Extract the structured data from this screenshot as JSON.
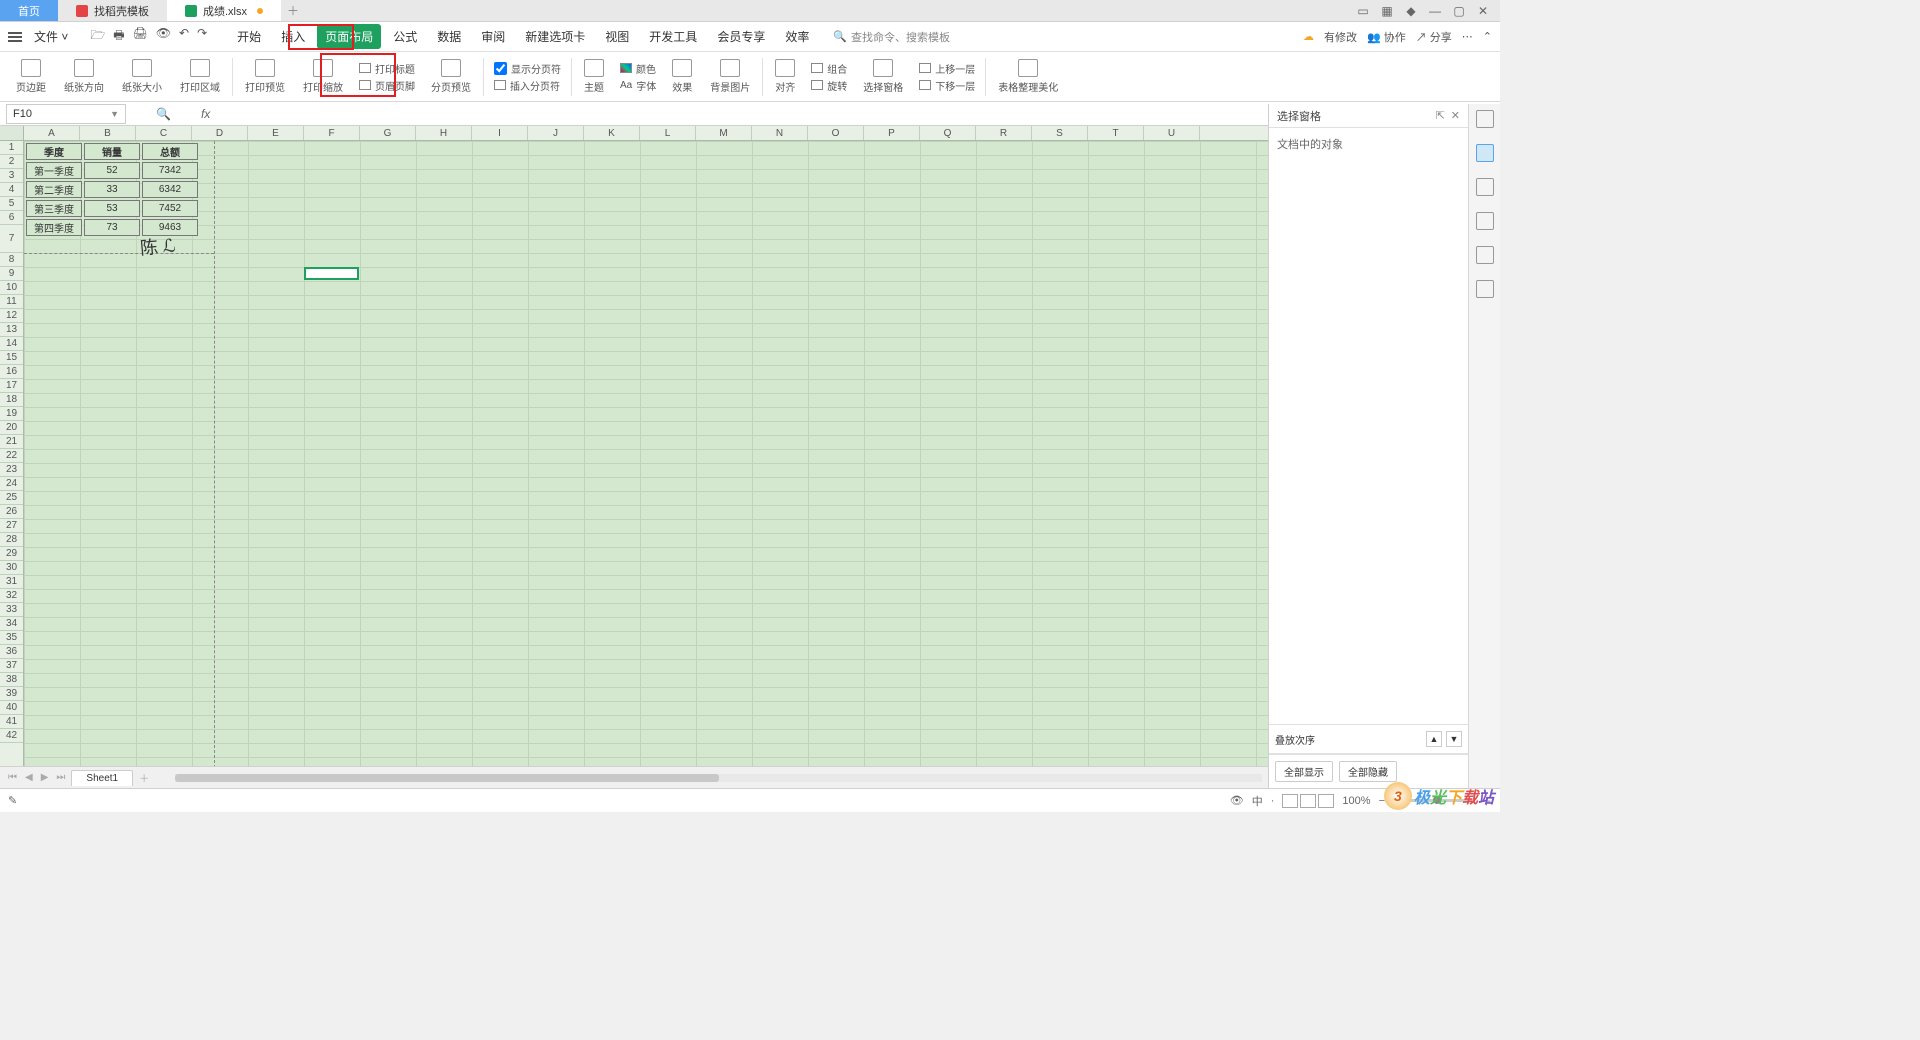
{
  "tabs": {
    "home": "首页",
    "template": "找稻壳模板",
    "file": "成绩.xlsx"
  },
  "menu": {
    "file": "文件",
    "items": [
      "开始",
      "插入",
      "页面布局",
      "公式",
      "数据",
      "审阅",
      "新建选项卡",
      "视图",
      "开发工具",
      "会员专享",
      "效率"
    ],
    "active": "页面布局",
    "search_placeholder": "查找命令、搜索模板"
  },
  "menu_right": {
    "modified": "有修改",
    "coop": "协作",
    "share": "分享"
  },
  "ribbon": {
    "margin": "页边距",
    "orient": "纸张方向",
    "size": "纸张大小",
    "area": "打印区域",
    "preview": "打印预览",
    "scale": "打印缩放",
    "titles": "打印标题",
    "headerfooter": "页眉页脚",
    "pagepreview": "分页预览",
    "showbreak": "显示分页符",
    "insertbreak": "插入分页符",
    "theme": "主题",
    "color": "颜色",
    "font": "字体",
    "effect": "效果",
    "bgimg": "背景图片",
    "align": "对齐",
    "group": "组合",
    "rotate": "旋转",
    "selpane": "选择窗格",
    "up": "上移一层",
    "down": "下移一层",
    "beautify": "表格整理美化"
  },
  "namebox": "F10",
  "columns": [
    "A",
    "B",
    "C",
    "D",
    "E",
    "F",
    "G",
    "H",
    "I",
    "J",
    "K",
    "L",
    "M",
    "N",
    "O",
    "P",
    "Q",
    "R",
    "S",
    "T",
    "U"
  ],
  "table": {
    "headers": [
      "季度",
      "销量",
      "总额"
    ],
    "rows": [
      [
        "第一季度",
        "52",
        "7342"
      ],
      [
        "第二季度",
        "33",
        "6342"
      ],
      [
        "第三季度",
        "53",
        "7452"
      ],
      [
        "第四季度",
        "73",
        "9463"
      ]
    ]
  },
  "taskpane": {
    "title": "选择窗格",
    "body": "文档中的对象",
    "order": "叠放次序",
    "show_all": "全部显示",
    "hide_all": "全部隐藏"
  },
  "sheet": {
    "name": "Sheet1"
  },
  "status": {
    "zoom": "100%"
  },
  "watermark": "极光下载站",
  "fx": "fx",
  "aa": "Aa"
}
